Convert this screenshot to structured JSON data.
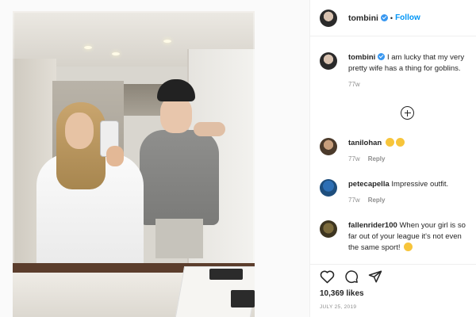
{
  "post": {
    "author": "tombini",
    "follow_label": "Follow",
    "dot": "•"
  },
  "caption": {
    "username": "tombini",
    "text": "I am lucky that my very pretty wife has a thing for goblins.",
    "age": "77w"
  },
  "comments": [
    {
      "username": "tanilohan",
      "text": "",
      "emoji": "grinning-face x2",
      "age": "77w",
      "reply_label": "Reply"
    },
    {
      "username": "petecapella",
      "text": "Impressive outfit.",
      "age": "77w",
      "reply_label": "Reply"
    },
    {
      "username": "fallenrider100",
      "text": "When your girl is so far out of your league it's not even the same sport!",
      "emoji": "smiling-face"
    }
  ],
  "stats": {
    "likes": "10,369 likes",
    "date": "JULY 25, 2019"
  },
  "colors": {
    "accent": "#0095f6",
    "verified": "#3897f0",
    "text": "#262626",
    "muted": "#8e8e8e"
  },
  "icons": [
    "verified-badge-icon",
    "load-more-comments-icon",
    "heart-icon",
    "comment-icon",
    "share-icon"
  ]
}
